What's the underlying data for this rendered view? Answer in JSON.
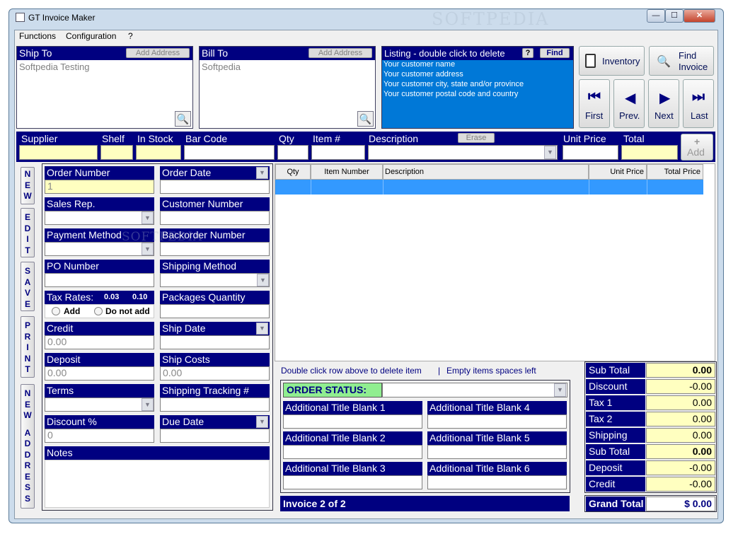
{
  "window": {
    "title": "GT Invoice Maker",
    "min": "—",
    "max": "☐",
    "close": "✕"
  },
  "menu": [
    "Functions",
    "Configuration",
    "?"
  ],
  "ship_to": {
    "label": "Ship To",
    "add_address": "Add Address",
    "value": "Softpedia Testing"
  },
  "bill_to": {
    "label": "Bill To",
    "add_address": "Add Address",
    "value": "Softpedia"
  },
  "listing": {
    "label": "Listing - double click to delete",
    "help": "?",
    "find": "Find",
    "lines": [
      "Your customer name",
      "Your customer address",
      "Your customer city, state and/or province",
      "Your customer postal code and country"
    ]
  },
  "nav": {
    "inventory": "Inventory",
    "find_invoice_1": "Find",
    "find_invoice_2": "Invoice",
    "first": "First",
    "prev": "Prev.",
    "next": "Next",
    "last": "Last"
  },
  "item_bar": {
    "supplier": "Supplier",
    "shelf": "Shelf",
    "in_stock": "In Stock",
    "bar_code": "Bar Code",
    "qty": "Qty",
    "item_num": "Item #",
    "description": "Description",
    "erase": "Erase",
    "unit_price": "Unit Price",
    "total": "Total",
    "add_plus": "+",
    "add": "Add"
  },
  "side_buttons": {
    "new": [
      "N",
      "E",
      "W"
    ],
    "edit": [
      "E",
      "D",
      "I",
      "T"
    ],
    "save": [
      "S",
      "A",
      "V",
      "E"
    ],
    "print": [
      "P",
      "R",
      "I",
      "N",
      "T"
    ],
    "new_address": [
      "N",
      "E",
      "W",
      "",
      "A",
      "D",
      "D",
      "R",
      "E",
      "S",
      "S"
    ]
  },
  "form": {
    "order_number": "Order Number",
    "order_number_value": "1",
    "order_date": "Order Date",
    "sales_rep": "Sales Rep.",
    "customer_number": "Customer Number",
    "payment_method": "Payment Method",
    "backorder_number": "Backorder Number",
    "po_number": "PO Number",
    "shipping_method": "Shipping Method",
    "tax_rates": "Tax Rates:",
    "tax1": "0.03",
    "tax2": "0.10",
    "add": "Add",
    "do_not_add": "Do not add",
    "packages_quantity": "Packages Quantity",
    "credit": "Credit",
    "credit_value": "0.00",
    "ship_date": "Ship Date",
    "deposit": "Deposit",
    "deposit_value": "0.00",
    "ship_costs": "Ship Costs",
    "ship_costs_value": "0.00",
    "terms": "Terms",
    "shipping_tracking": "Shipping Tracking  #",
    "discount": "Discount %",
    "discount_value": "0",
    "due_date": "Due Date",
    "notes": "Notes"
  },
  "grid": {
    "columns": [
      "Qty",
      "Item Number",
      "Description",
      "Unit Price",
      "Total Price"
    ]
  },
  "hint": {
    "left": "Double click row above to delete item",
    "sep": "|",
    "right": "Empty items spaces left"
  },
  "order_status": {
    "label": "ORDER STATUS:",
    "blanks": [
      "Additional Title Blank 1",
      "Additional Title Blank 4",
      "Additional Title Blank 2",
      "Additional Title Blank 5",
      "Additional Title Blank 3",
      "Additional Title Blank 6"
    ]
  },
  "invoice_counter": "Invoice 2 of 2",
  "totals": [
    {
      "label": "Sub Total",
      "value": "0.00",
      "bold": true
    },
    {
      "label": "Discount",
      "value": "-0.00"
    },
    {
      "label": "Tax 1",
      "value": "0.00"
    },
    {
      "label": "Tax 2",
      "value": "0.00"
    },
    {
      "label": "Shipping",
      "value": "0.00"
    },
    {
      "label": "Sub Total",
      "value": "0.00",
      "bold": true
    },
    {
      "label": "Deposit",
      "value": "-0.00"
    },
    {
      "label": "Credit",
      "value": "-0.00"
    }
  ],
  "grand_total": {
    "label": "Grand Total",
    "value": "$ 0.00"
  },
  "watermark": "SOFTPEDIA"
}
